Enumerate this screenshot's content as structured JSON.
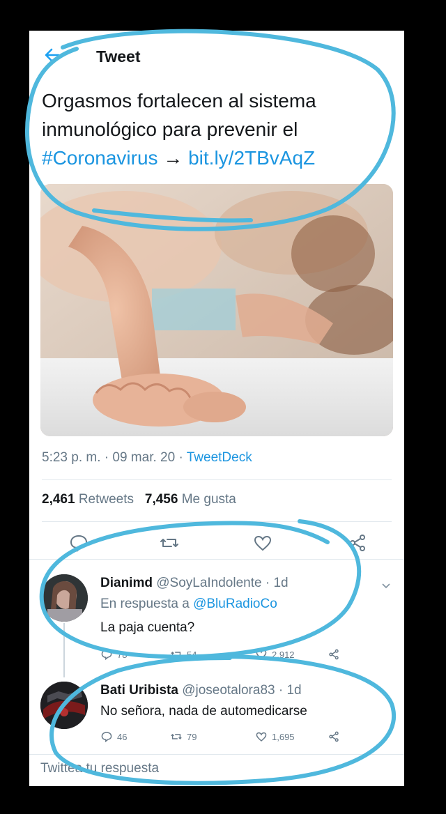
{
  "header": {
    "title": "Tweet",
    "back_icon": "back-arrow-icon"
  },
  "tweet": {
    "text_line1": "Orgasmos fortalecen al sistema",
    "text_line2": "inmunológico para prevenir el",
    "hashtag": "#Coronavirus",
    "arrow": " → ",
    "link": "bit.ly/2TBvAqZ",
    "time": "5:23 p. m.",
    "date": "09 mar. 20",
    "app": "TweetDeck",
    "separator": " · ",
    "retweets_count": "2,461",
    "retweets_label": "Retweets",
    "likes_count": "7,456",
    "likes_label": "Me gusta"
  },
  "replies": [
    {
      "name": "Dianimd",
      "handle": "@SoyLaIndolente",
      "age": "1d",
      "in_reply_prefix": "En respuesta a ",
      "in_reply_to": "@BluRadioCo",
      "text": "La paja cuenta?",
      "reply_count": "78",
      "retweet_count": "54",
      "like_count": "2,912"
    },
    {
      "name": "Bati Uribista",
      "handle": "@joseotalora83",
      "age": "1d",
      "text": "No señora, nada de automedicarse",
      "reply_count": "46",
      "retweet_count": "79",
      "like_count": "1,695"
    }
  ],
  "compose": {
    "placeholder": "Twittea tu respuesta"
  },
  "colors": {
    "link": "#1b95e0",
    "annotation": "#4fb8dd",
    "muted": "#657786"
  }
}
